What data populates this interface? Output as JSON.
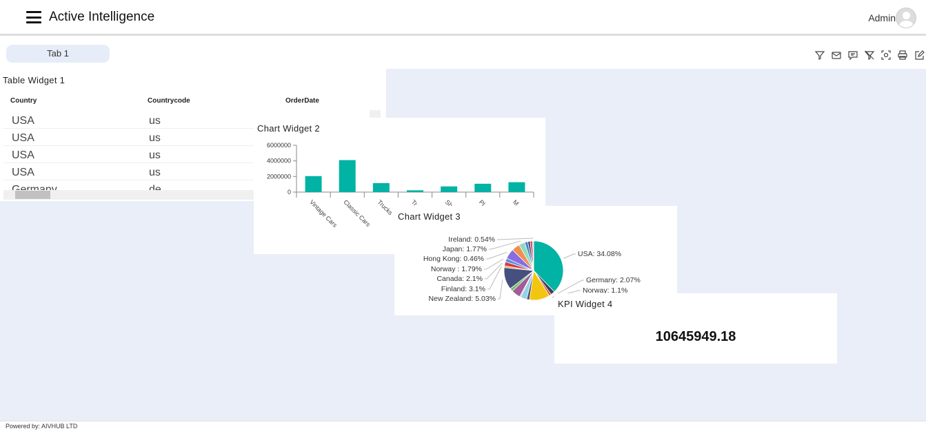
{
  "header": {
    "title": "Active Intelligence",
    "user": "Admin"
  },
  "tabs": [
    {
      "label": "Tab 1"
    }
  ],
  "toolbar": [
    "filter-icon",
    "mail-icon",
    "comment-icon",
    "clear-filter-icon",
    "screenshot-icon",
    "print-icon",
    "edit-icon"
  ],
  "table_widget": {
    "title": "Table Widget 1",
    "columns": [
      "Country",
      "Countrycode",
      "OrderDate"
    ],
    "rows": [
      [
        "USA",
        "us",
        ""
      ],
      [
        "USA",
        "us",
        ""
      ],
      [
        "USA",
        "us",
        ""
      ],
      [
        "USA",
        "us",
        ""
      ],
      [
        "Germany",
        "de",
        ""
      ]
    ]
  },
  "chart_widget_2": {
    "title": "Chart Widget 2"
  },
  "chart_widget_3": {
    "title": "Chart Widget 3"
  },
  "kpi_widget": {
    "title": "KPI Widget 4",
    "value": "10645949.18"
  },
  "footer": {
    "text": "Powered by: AIVHUB LTD"
  },
  "colors": {
    "accent": "#00b3a4",
    "canvas": "#eaeef8"
  },
  "chart_data": [
    {
      "type": "bar",
      "title": "Chart Widget 2",
      "categories": [
        "Vintage Cars",
        "Classic Cars",
        "Trucks",
        "Tr",
        "Sh",
        "Pl",
        "M"
      ],
      "values": [
        2050000,
        4100000,
        1150000,
        230000,
        730000,
        1070000,
        1270000
      ],
      "yticks": [
        "0",
        "2000000",
        "4000000",
        "6000000"
      ],
      "ylim": [
        0,
        6000000
      ],
      "color": "#00b3a4"
    },
    {
      "type": "pie",
      "title": "Chart Widget 3",
      "slices": [
        {
          "label": "USA: 34.08%",
          "value": 34.08,
          "color": "#00b3a4"
        },
        {
          "label": "Germany: 2.07%",
          "value": 2.07,
          "color": "#3b4150"
        },
        {
          "label": "Norway: 1.1%",
          "value": 1.1,
          "color": "#e0483e"
        },
        {
          "label": "",
          "value": 10,
          "color": "#f2c511"
        },
        {
          "label": "",
          "value": 1.5,
          "color": "#555a66"
        },
        {
          "label": "",
          "value": 3,
          "color": "#8fd3ea"
        },
        {
          "label": "",
          "value": 0.6,
          "color": "#f0a0c0"
        },
        {
          "label": "",
          "value": 4.5,
          "color": "#a05d9a"
        },
        {
          "label": "",
          "value": 1.5,
          "color": "#6cbf5a"
        },
        {
          "label": "New Zealand: 5.03%",
          "value": 11,
          "color": "#46507e"
        },
        {
          "label": "Finland: 3.1%",
          "value": 0.8,
          "color": "#f09040"
        },
        {
          "label": "Canada: 2.1%",
          "value": 2.1,
          "color": "#d04040"
        },
        {
          "label": "Norway : 1.79%",
          "value": 1.79,
          "color": "#5a8fe0"
        },
        {
          "label": "Hong Kong: 0.46%",
          "value": 5,
          "color": "#8b6be0"
        },
        {
          "label": "",
          "value": 4,
          "color": "#f09050"
        },
        {
          "label": "Japan: 1.77%",
          "value": 3,
          "color": "#8fdcc0"
        },
        {
          "label": "",
          "value": 1.5,
          "color": "#4a7fd0"
        },
        {
          "label": "",
          "value": 1.2,
          "color": "#3c4a7a"
        },
        {
          "label": "",
          "value": 1.2,
          "color": "#e05050"
        },
        {
          "label": "Ireland: 0.54%",
          "value": 0.54,
          "color": "#c8d8f0"
        }
      ]
    }
  ]
}
